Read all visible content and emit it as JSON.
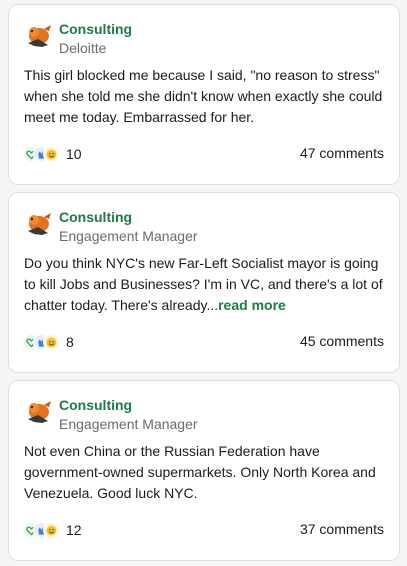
{
  "posts": [
    {
      "group": "Consulting",
      "subtitle": "Deloitte",
      "body": "This girl blocked me because I said, \"no reason to stress\" when she told me she didn't know when exactly she could meet me today. Embarrassed for her.",
      "read_more": "",
      "reaction_count": "10",
      "comments": "47 comments"
    },
    {
      "group": "Consulting",
      "subtitle": "Engagement Manager",
      "body": "Do you think NYC's new Far-Left Socialist mayor is going to kill Jobs and Businesses? I'm in VC, and there's a lot of chatter today. There's already...",
      "read_more": "read more",
      "reaction_count": "8",
      "comments": "45 comments"
    },
    {
      "group": "Consulting",
      "subtitle": "Engagement Manager",
      "body": "Not even China or the Russian Federation have government-owned supermarkets. Only North Korea and Venezuela. Good luck NYC.",
      "read_more": "",
      "reaction_count": "12",
      "comments": "37 comments"
    }
  ],
  "icons": {
    "avatar": "consulting-group-logo",
    "reactions": [
      "heart-icon",
      "clap-icon",
      "smile-icon"
    ]
  },
  "colors": {
    "accent": "#1f7a4a",
    "card_border": "#dedede",
    "muted_text": "#6b6b6b"
  }
}
